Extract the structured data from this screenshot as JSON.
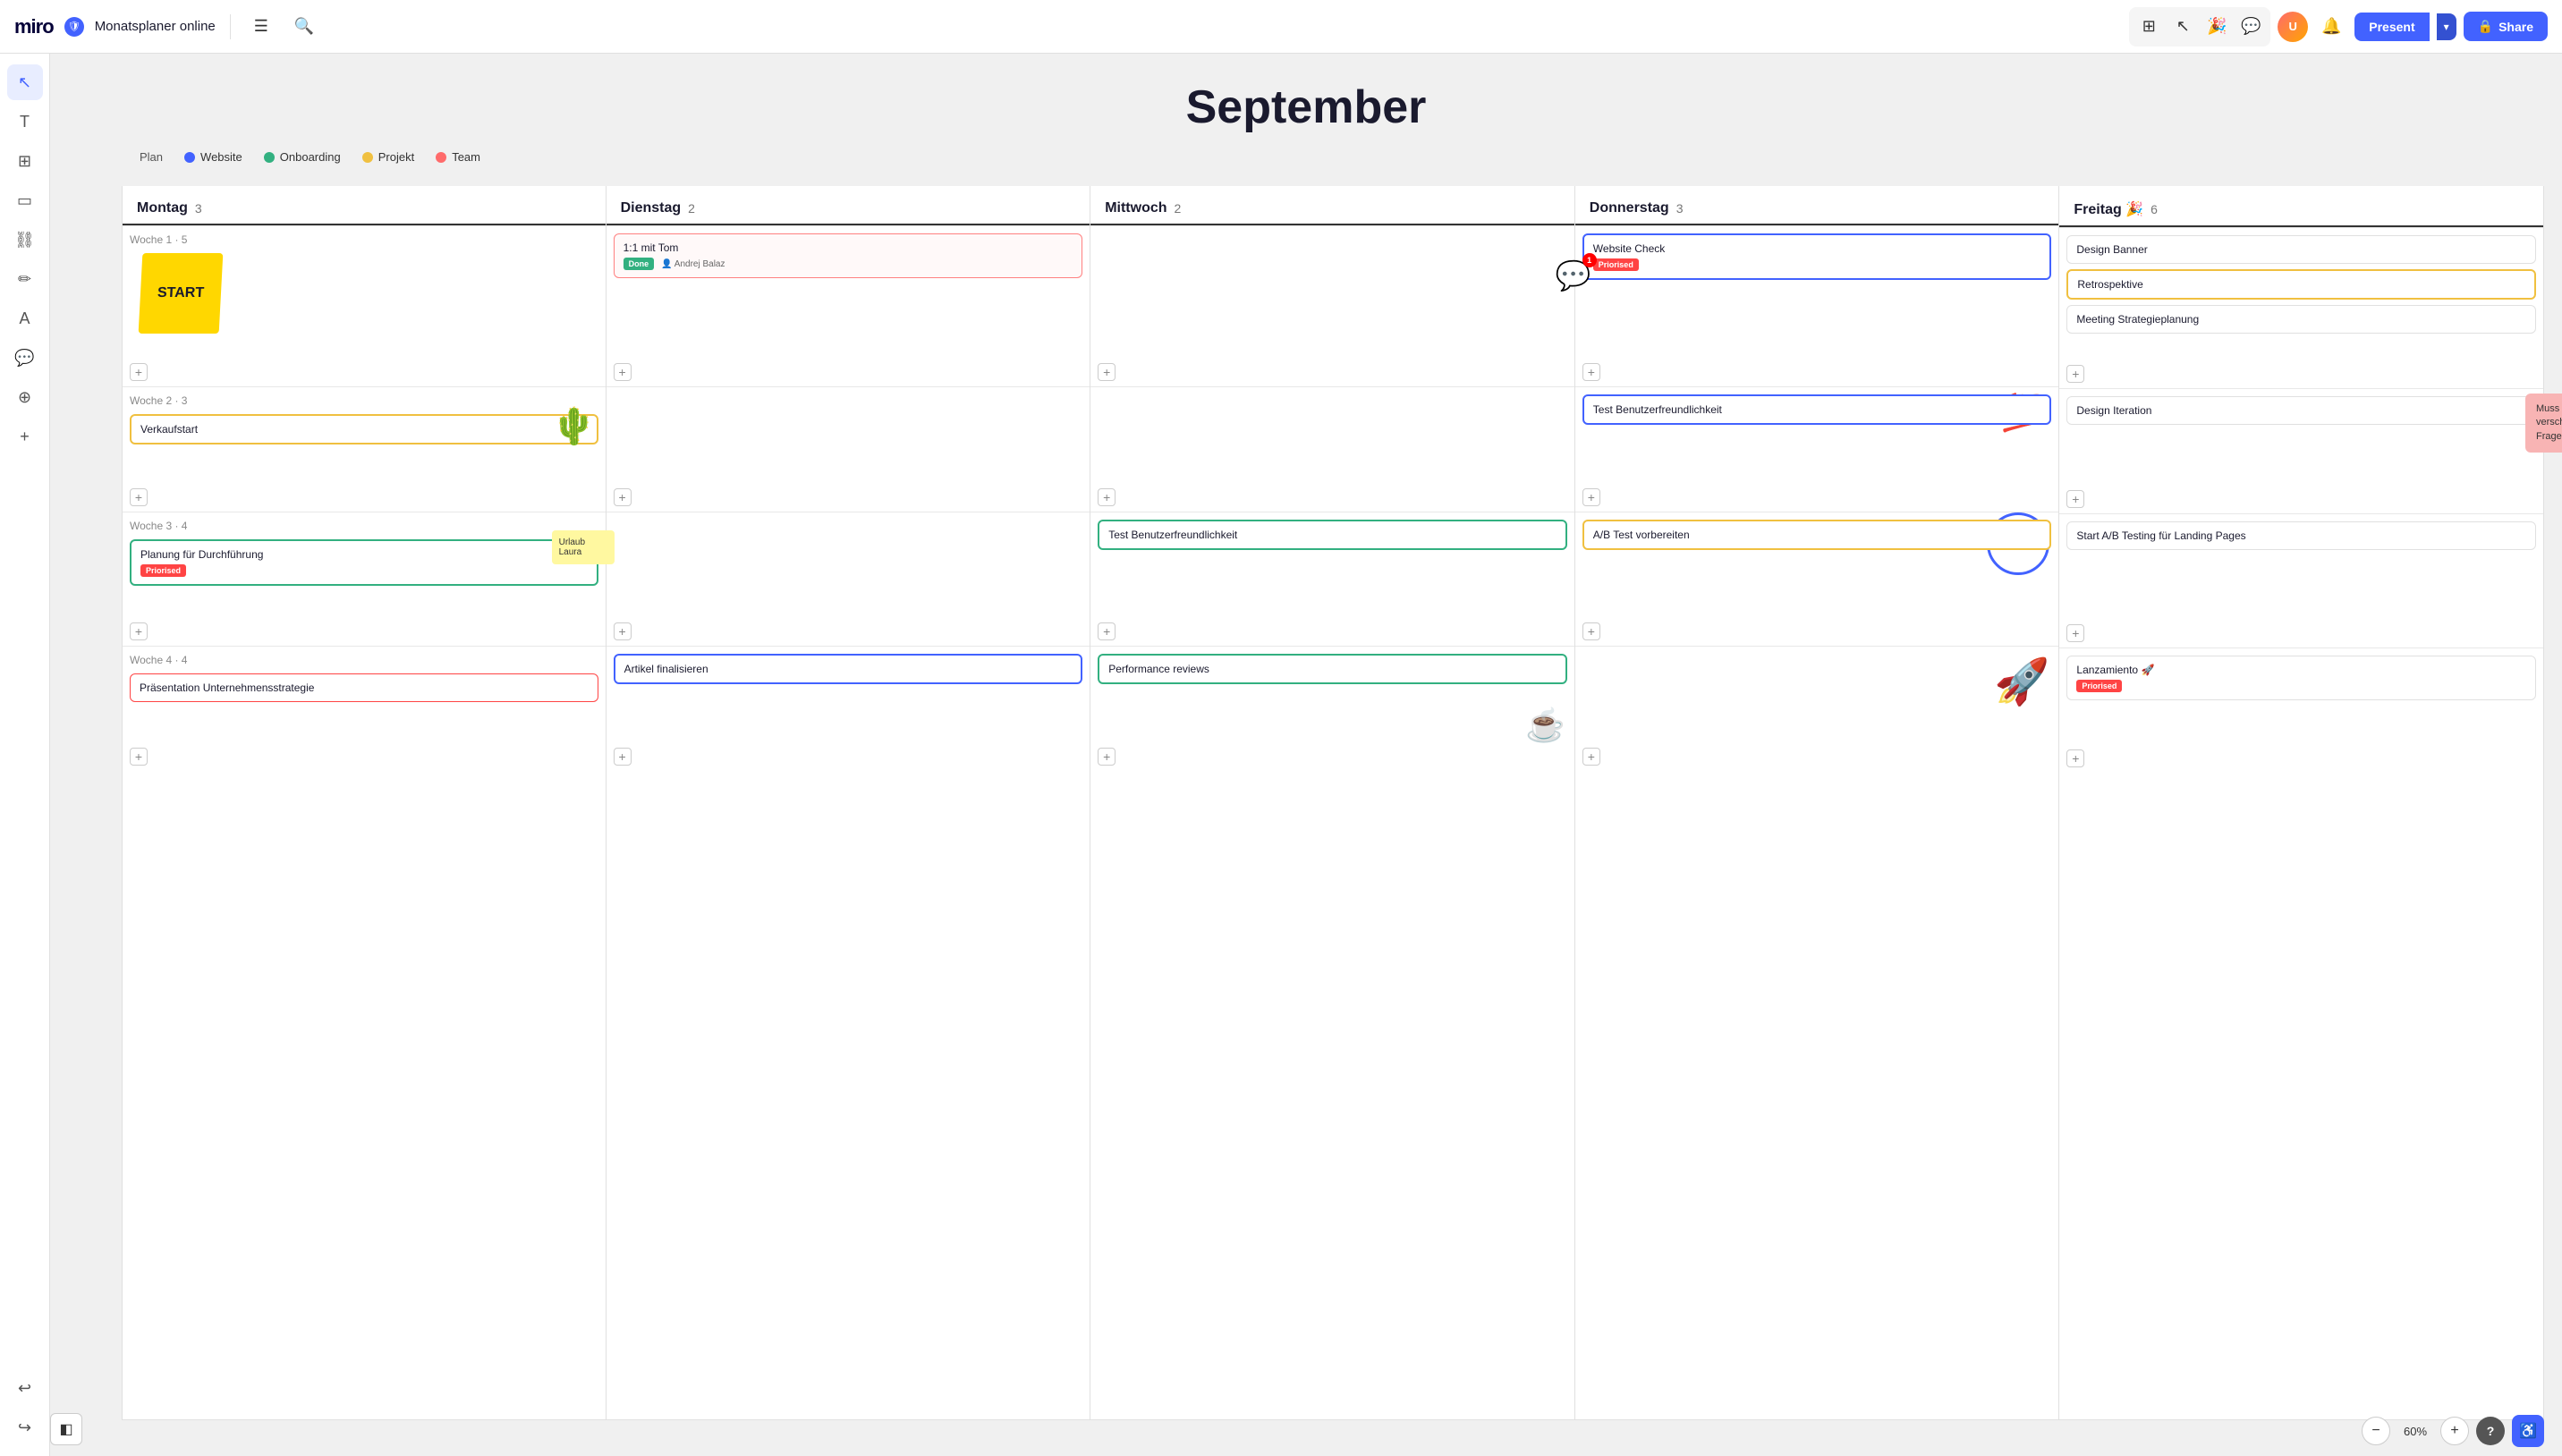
{
  "app": {
    "name": "miro",
    "board_title": "Monatsplaner online"
  },
  "toolbar": {
    "present_label": "Present",
    "share_label": "Share",
    "zoom_level": "60%"
  },
  "page": {
    "title": "September"
  },
  "legend": {
    "plan_label": "Plan",
    "items": [
      {
        "id": "website",
        "label": "Website",
        "color": "#4262ff"
      },
      {
        "id": "onboarding",
        "label": "Onboarding",
        "color": "#32b080"
      },
      {
        "id": "projekt",
        "label": "Projekt",
        "color": "#f0c040"
      },
      {
        "id": "team",
        "label": "Team",
        "color": "#ff6b6b"
      }
    ]
  },
  "days": [
    {
      "name": "Montag",
      "count": "3"
    },
    {
      "name": "Dienstag",
      "count": "2"
    },
    {
      "name": "Mittwoch",
      "count": "2"
    },
    {
      "name": "Donnerstag",
      "count": "3"
    },
    {
      "name": "Freitag 🎉",
      "count": "6"
    }
  ],
  "weeks": [
    {
      "label": "Woche 1",
      "count": "5",
      "tasks": {
        "montag": [],
        "dienstag": [
          {
            "id": "t1",
            "title": "1:1 mit Tom",
            "border": "red-border",
            "badge": "Done",
            "badge_type": "badge-done",
            "assignee": "Andrej Balaz"
          }
        ],
        "mittwoch": [],
        "donnerstag": [
          {
            "id": "t2",
            "title": "Website Check",
            "border": "blue-border",
            "badge": "Priorised",
            "badge_type": "badge-red"
          }
        ],
        "freitag": [
          {
            "id": "t3",
            "title": "Design Banner",
            "border": "plain-border"
          },
          {
            "id": "t4",
            "title": "Retrospektive",
            "border": "yellow-border"
          },
          {
            "id": "t5",
            "title": "Meeting Strategieplanung",
            "border": "plain-border"
          }
        ]
      }
    },
    {
      "label": "Woche 2",
      "count": "3",
      "tasks": {
        "montag": [
          {
            "id": "t6",
            "title": "Verkaufstart",
            "border": "yellow-border"
          }
        ],
        "dienstag": [],
        "mittwoch": [],
        "donnerstag": [
          {
            "id": "t7",
            "title": "Test Benutzerfreundlichkeit",
            "border": "blue-border"
          }
        ],
        "freitag": [
          {
            "id": "t8",
            "title": "Design Iteration",
            "border": "plain-border"
          }
        ]
      }
    },
    {
      "label": "Woche 3",
      "count": "4",
      "tasks": {
        "montag": [
          {
            "id": "t9",
            "title": "Planung für Durchführung",
            "border": "green-border",
            "badge": "Priorised",
            "badge_type": "badge-red"
          }
        ],
        "dienstag": [],
        "mittwoch": [
          {
            "id": "t10",
            "title": "Test Benutzerfreundlichkeit",
            "border": "green-border"
          }
        ],
        "donnerstag": [
          {
            "id": "t11",
            "title": "A/B Test vorbereiten",
            "border": "yellow-border"
          }
        ],
        "freitag": [
          {
            "id": "t12",
            "title": "Start A/B Testing für Landing Pages",
            "border": "plain-border"
          }
        ]
      }
    },
    {
      "label": "Woche 4",
      "count": "4",
      "tasks": {
        "montag": [
          {
            "id": "t13",
            "title": "Präsentation Unternehmensstrategie",
            "border": "red-border-solid"
          }
        ],
        "dienstag": [
          {
            "id": "t14",
            "title": "Artikel finalisieren",
            "border": "blue-border"
          }
        ],
        "mittwoch": [
          {
            "id": "t15",
            "title": "Performance reviews",
            "border": "green-border"
          }
        ],
        "donnerstag": [],
        "freitag": [
          {
            "id": "t16",
            "title": "Lanzamiento 🚀",
            "border": "plain-border",
            "badge": "Priorised",
            "badge_type": "badge-red"
          }
        ]
      }
    }
  ],
  "callout": {
    "text": "Muss auf nächste Woche verschoben werden. Fragen an Anna"
  },
  "sticky_note": {
    "text": "Urlaub Laura"
  },
  "icons": {
    "cursor": "↖",
    "text": "T",
    "table": "⊞",
    "sticky": "□",
    "link": "🔗",
    "pen": "✏",
    "letter": "A",
    "comment": "💬",
    "frame": "+",
    "more": "+",
    "undo": "↩",
    "redo": "↪",
    "sidebar": "☰"
  }
}
